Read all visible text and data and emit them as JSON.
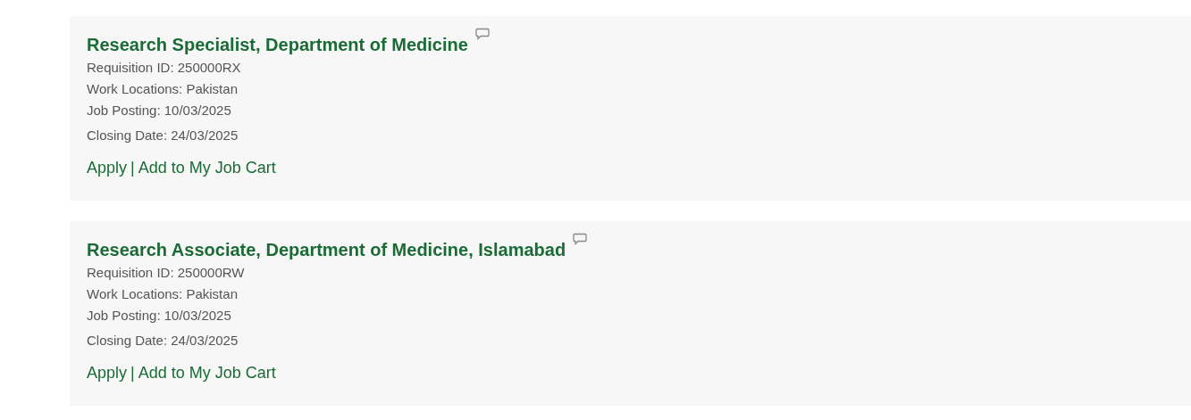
{
  "jobs": [
    {
      "title": "Research Specialist, Department of Medicine",
      "details": [
        "Requisition ID: 250000RX",
        "Work Locations: Pakistan",
        "Job Posting: 10/03/2025",
        "Closing Date: 24/03/2025"
      ],
      "links": [
        "Apply",
        "Add to My Job Cart"
      ],
      "separator": "|"
    },
    {
      "title": "Research Associate, Department of Medicine, Islamabad",
      "details": [
        "Requisition ID: 250000RW",
        "Work Locations: Pakistan",
        "Job Posting: 10/03/2025",
        "Closing Date: 24/03/2025"
      ],
      "links": [
        "Apply",
        "Add to My Job Cart"
      ],
      "separator": "|"
    }
  ]
}
